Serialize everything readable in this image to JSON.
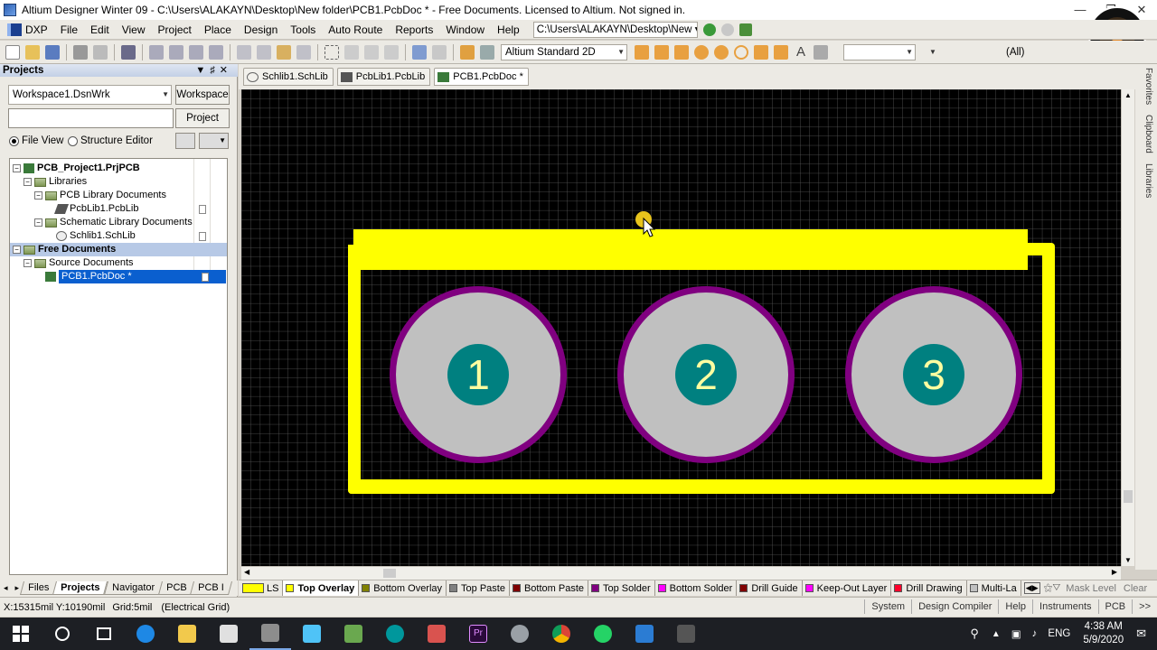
{
  "window": {
    "title": "Altium Designer Winter 09 - C:\\Users\\ALAKAYN\\Desktop\\New folder\\PCB1.PcbDoc * - Free Documents. Licensed to Altium. Not signed in."
  },
  "menu": {
    "dxp": "DXP",
    "items": [
      "File",
      "Edit",
      "View",
      "Project",
      "Place",
      "Design",
      "Tools",
      "Auto Route",
      "Reports",
      "Window",
      "Help"
    ],
    "path": "C:\\Users\\ALAKAYN\\Desktop\\New ▾"
  },
  "toolbar": {
    "view_mode": "Altium Standard 2D",
    "filter": "(All)"
  },
  "projects_panel": {
    "title": "Projects",
    "workspace_value": "Workspace1.DsnWrk",
    "workspace_button": "Workspace",
    "project_input": "",
    "project_button": "Project",
    "view_file": "File View",
    "view_structure": "Structure Editor",
    "tree": {
      "project": "PCB_Project1.PrjPCB",
      "libraries": "Libraries",
      "pcb_lib_docs": "PCB Library Documents",
      "pcblib": "PcbLib1.PcbLib",
      "sch_lib_docs": "Schematic Library Documents",
      "schlib": "Schlib1.SchLib",
      "free_docs": "Free Documents",
      "source_docs": "Source Documents",
      "pcbdoc": "PCB1.PcbDoc *"
    },
    "tabs": [
      "Files",
      "Projects",
      "Navigator",
      "PCB",
      "PCB I"
    ]
  },
  "doc_tabs": [
    "Schlib1.SchLib",
    "PcbLib1.PcbLib",
    "PCB1.PcbDoc *"
  ],
  "pcb": {
    "pads": [
      "1",
      "2",
      "3"
    ],
    "colors": {
      "background": "#000000",
      "grid": "#5a5a5a",
      "overlay": "#ffff00",
      "pad": "#c0c0c0",
      "solder_mask": "#800080",
      "hole": "#008080",
      "pad_text": "#fffda0"
    }
  },
  "layer_tabs": {
    "ls": "LS",
    "layers": [
      {
        "label": "Top Overlay",
        "color": "#ffff00",
        "active": true
      },
      {
        "label": "Bottom Overlay",
        "color": "#808000"
      },
      {
        "label": "Top Paste",
        "color": "#808080"
      },
      {
        "label": "Bottom Paste",
        "color": "#800000"
      },
      {
        "label": "Top Solder",
        "color": "#800080"
      },
      {
        "label": "Bottom Solder",
        "color": "#ff00ff"
      },
      {
        "label": "Drill Guide",
        "color": "#800000"
      },
      {
        "label": "Keep-Out Layer",
        "color": "#ff00ff"
      },
      {
        "label": "Drill Drawing",
        "color": "#ff002a"
      },
      {
        "label": "Multi-La",
        "color": "#c0c0c0"
      }
    ],
    "mask_level": "Mask Level",
    "clear": "Clear"
  },
  "status": {
    "coords": "X:15315mil Y:10190mil",
    "grid": "Grid:5mil",
    "grid_type": "(Electrical Grid)",
    "right": [
      "System",
      "Design Compiler",
      "Help",
      "Instruments",
      "PCB",
      ">>"
    ]
  },
  "side_tabs": [
    "Favorites",
    "Clipboard",
    "Libraries"
  ],
  "taskbar": {
    "lang": "ENG",
    "time": "4:38 AM",
    "date": "5/9/2020"
  }
}
